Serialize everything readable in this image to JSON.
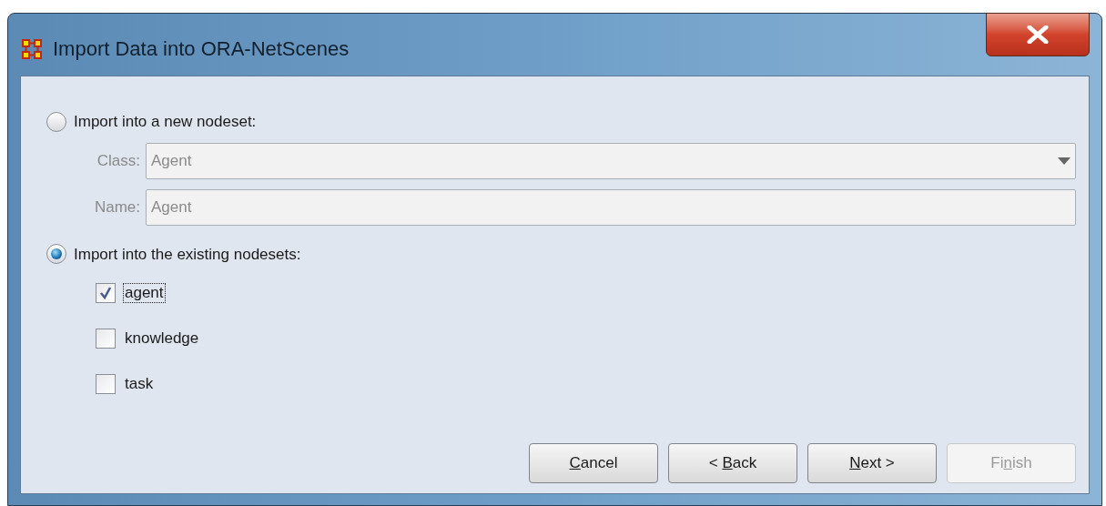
{
  "window": {
    "title": "Import Data into ORA-NetScenes"
  },
  "options": [
    {
      "label": "Import into a new nodeset:",
      "selected": false
    },
    {
      "label": "Import into the existing nodesets:",
      "selected": true
    }
  ],
  "new_nodeset": {
    "disabled": true,
    "class": {
      "label": "Class:",
      "value": "Agent"
    },
    "name": {
      "label": "Name:",
      "value": "Agent"
    }
  },
  "nodesets": [
    {
      "label": "agent",
      "checked": true,
      "focused": true
    },
    {
      "label": "knowledge",
      "checked": false,
      "focused": false
    },
    {
      "label": "task",
      "checked": false,
      "focused": false
    }
  ],
  "buttons": [
    {
      "mnemonic": "C",
      "after": "ancel",
      "disabled": false
    },
    {
      "before": "< ",
      "mnemonic": "B",
      "after": "ack",
      "disabled": false
    },
    {
      "mnemonic": "N",
      "after": "ext >",
      "disabled": false
    },
    {
      "before": "Fi",
      "mnemonic": "n",
      "after": "ish",
      "disabled": true
    }
  ]
}
